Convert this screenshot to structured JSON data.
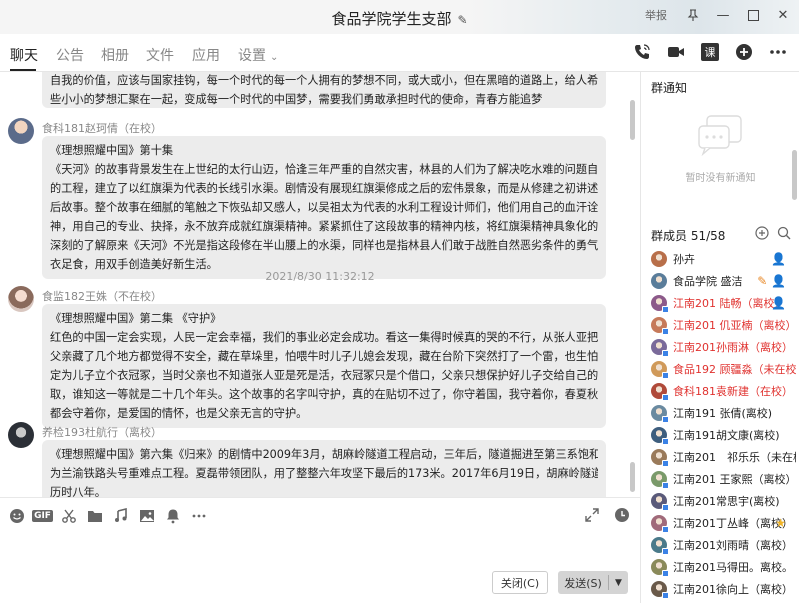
{
  "window": {
    "title": "食品学院学生支部",
    "report": "举报"
  },
  "tabs": [
    {
      "label": "聊天"
    },
    {
      "label": "公告"
    },
    {
      "label": "相册"
    },
    {
      "label": "文件"
    },
    {
      "label": "应用"
    },
    {
      "label": "设置"
    }
  ],
  "toolbar": {
    "lesson_label": "课"
  },
  "chat": {
    "top_fragment": [
      "自我的价值，应该与国家挂钩，每一个时代的每一个人拥有的梦想不同，或大或小，但在黑暗的道路上，给人希望和方向，只有当这",
      "些小小的梦想汇聚在一起，变成每一个时代的中国梦，需要我们勇敢承担时代的使命，青春方能追梦"
    ],
    "messages": [
      {
        "sender": "食科181赵珂倩（在校）",
        "lines": [
          "《理想照耀中国》第十集",
          "《天河》的故事背景发生在上世纪的太行山迈，恰逢三年严重的自然灾害，林县的人们为了解决吃水难的问题自发的开展了修渠引水",
          "的工程，建立了以红旗渠为代表的长线引水渠。剧情没有展现红旗渠修成之后的宏伟景象，而是从修建之初讲述了一些触人心旋的背",
          "后故事。整个故事在细腻的笔触之下恢弘却又感人，以吴祖太为代表的水利工程设计师们，他们用自己的血汗诠释这什么叫做奉献精",
          "神，用自己的专业、抉择，永不放弃成就红旗渠精神。紧紧抓住了这段故事的精神内核，将红旗渠精神具象化的展现给我们，让我们",
          "深刻的了解原来《天河》不光是指这段修在半山腰上的水渠，同样也是指林县人们敢于战胜自然恶劣条件的勇气和决心，自己动手丰",
          "衣足食，用双手创造美好新生活。"
        ]
      },
      {
        "timestamp": "2021/8/30 11:32:12",
        "sender": "食监182王姝（不在校）",
        "lines": [
          "《理想照耀中国》第二集 《守护》",
          "红色的中国一定会实现，人民一定会幸福，我们的事业必定会成功。看这一集得时候真的哭的不行，从张人亚把资料交给父亲保管，",
          "父亲藏了几个地方都觉得不安全，藏在草垛里，怕喂牛时儿子儿媳会发现，藏在台阶下突然打了一个雷，也生怕会被发现，最后决",
          "定为儿子立个衣冠冢，当时父亲也不知道张人亚是死是活，衣冠冢只是个借口，父亲只想保护好儿子交给自己的东西，等儿子回来",
          "取，谁知这一等就是二十几个年头。这个故事的名字叫守护，真的在贴切不过了，你守着国，我守着你，春夏秋冬不论刮风下雨，我",
          "都会守着你，是爱国的情怀，也是父亲无言的守护。"
        ]
      },
      {
        "sender": "养检193杜航行（离校）",
        "lines": [
          "《理想照耀中国》第六集《归来》的剧情中2009年3月，胡麻岭隧道工程启动，三年后，隧道掘进至第三系饱和富水粉细砂层，被定",
          "为兰渝铁路头号重难点工程。夏磊带领团队，用了整整六年攻坚下最后的173米。2017年6月19日，胡麻岭隧道工程竣工，整个工程",
          "历时八年。"
        ]
      }
    ]
  },
  "input": {
    "close_label": "关闭(C)",
    "send_label": "发送(S)"
  },
  "notice": {
    "title": "群通知",
    "empty_text": "暂时没有新通知"
  },
  "members": {
    "header": "群成员 51/58",
    "list": [
      {
        "name": "孙卉",
        "red": false,
        "badge": "owner"
      },
      {
        "name": "食品学院 盛洁",
        "red": false,
        "badge": "admin-edit"
      },
      {
        "name": "江南201 陆畅（离校）",
        "red": true,
        "badge": "admin"
      },
      {
        "name": "江南201 仉亚楠（离校）",
        "red": true,
        "badge": ""
      },
      {
        "name": "江南201孙雨淋（离校）",
        "red": true,
        "badge": ""
      },
      {
        "name": "食品192 顾疆淼（未在校）",
        "red": true,
        "badge": ""
      },
      {
        "name": "食科181袁新建（在校）",
        "red": true,
        "badge": ""
      },
      {
        "name": "江南191 张倩(离校)",
        "red": false,
        "badge": ""
      },
      {
        "name": "江南191胡文康(离校)",
        "red": false,
        "badge": ""
      },
      {
        "name": "江南201　祁乐乐（未在校）",
        "red": false,
        "badge": ""
      },
      {
        "name": "江南201 王家熙（离校）",
        "red": false,
        "badge": ""
      },
      {
        "name": "江南201常思宇(离校)",
        "red": false,
        "badge": ""
      },
      {
        "name": "江南201丁丛峰（离校）",
        "red": false,
        "badge": "star"
      },
      {
        "name": "江南201刘雨晴（离校）",
        "red": false,
        "badge": ""
      },
      {
        "name": "江南201马得田。离校。",
        "red": false,
        "badge": ""
      },
      {
        "name": "江南201徐向上（离校）",
        "red": false,
        "badge": ""
      }
    ]
  }
}
